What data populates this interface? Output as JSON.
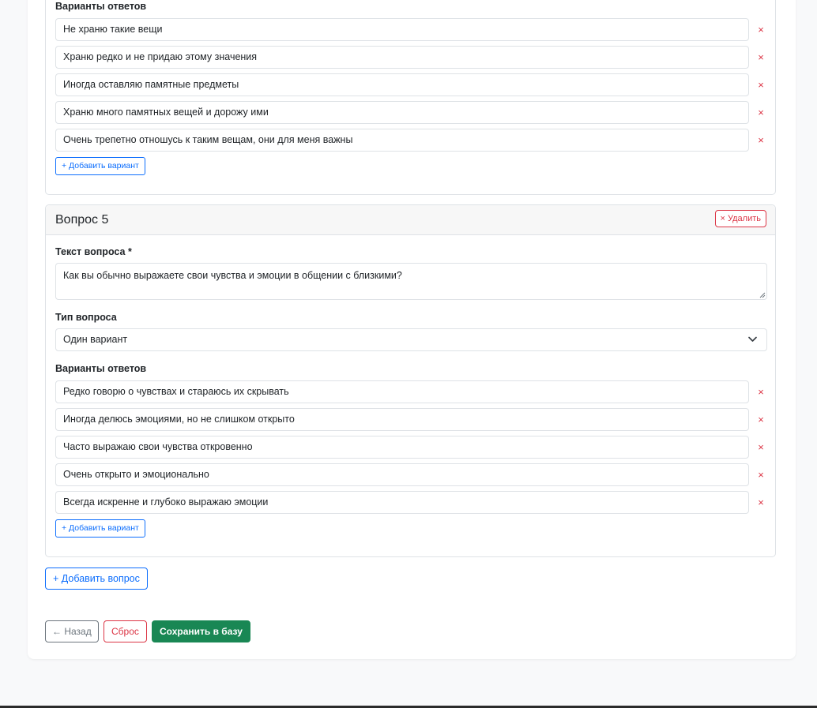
{
  "previous_question": {
    "options_label": "Варианты ответов",
    "options": [
      "Не храню такие вещи",
      "Храню редко и не придаю этому значения",
      "Иногда оставляю памятные предметы",
      "Храню много памятных вещей и дорожу ими",
      "Очень трепетно отношусь к таким вещам, они для меня важны"
    ],
    "remove_glyph": "×",
    "add_option_label": "+ Добавить вариант"
  },
  "question5": {
    "title": "Вопрос 5",
    "delete_label": "× Удалить",
    "text_label": "Текст вопроса *",
    "text_value": "Как вы обычно выражаете свои чувства и эмоции в общении с близкими?",
    "type_label": "Тип вопроса",
    "type_value": "Один вариант",
    "options_label": "Варианты ответов",
    "options": [
      "Редко говорю о чувствах и стараюсь их скрывать",
      "Иногда делюсь эмоциями, но не слишком открыто",
      "Часто выражаю свои чувства откровенно",
      "Очень открыто и эмоционально",
      "Всегда искренне и глубоко выражаю эмоции"
    ],
    "remove_glyph": "×",
    "add_option_label": "+ Добавить вариант"
  },
  "actions": {
    "add_question": "+ Добавить вопрос",
    "back": "← Назад",
    "reset": "Сброс",
    "save": "Сохранить в базу"
  },
  "colors": {
    "primary": "#0d6efd",
    "danger": "#dc3545",
    "success": "#198754",
    "secondary": "#6c757d"
  }
}
